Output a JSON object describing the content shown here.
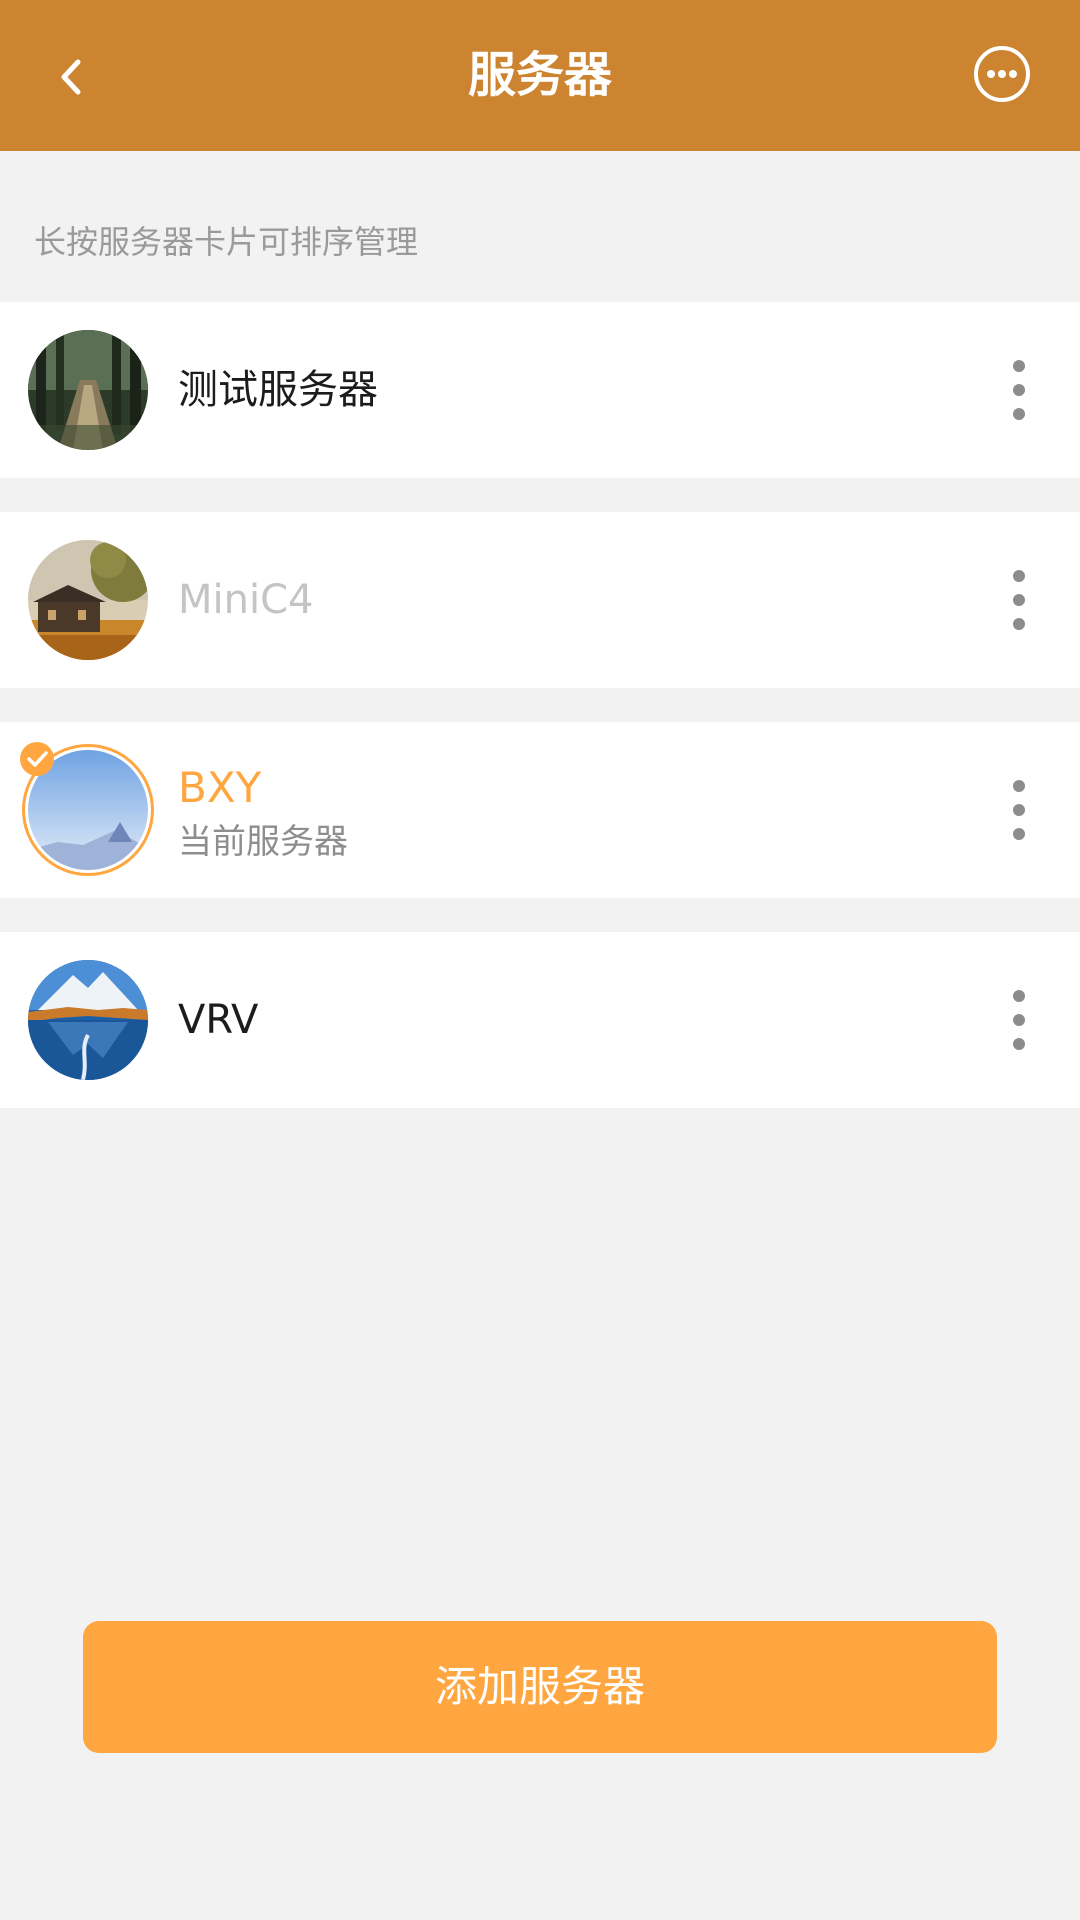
{
  "header": {
    "title": "服务器",
    "back_icon": "chevron-left-icon",
    "more_icon": "more-circle-icon"
  },
  "hint": "长按服务器卡片可排序管理",
  "servers": [
    {
      "name": "测试服务器",
      "subtitle": "",
      "state": "normal",
      "avatar": "forest-path-image"
    },
    {
      "name": "MiniC4",
      "subtitle": "",
      "state": "disabled",
      "avatar": "cabin-sunset-image"
    },
    {
      "name": "BXY",
      "subtitle": "当前服务器",
      "state": "current",
      "avatar": "blue-sky-mountain-image"
    },
    {
      "name": "VRV",
      "subtitle": "",
      "state": "normal",
      "avatar": "mountain-lake-image"
    }
  ],
  "add_button": "添加服务器",
  "colors": {
    "header": "#cc8430",
    "accent": "#ffa640",
    "background": "#f2f2f2"
  }
}
